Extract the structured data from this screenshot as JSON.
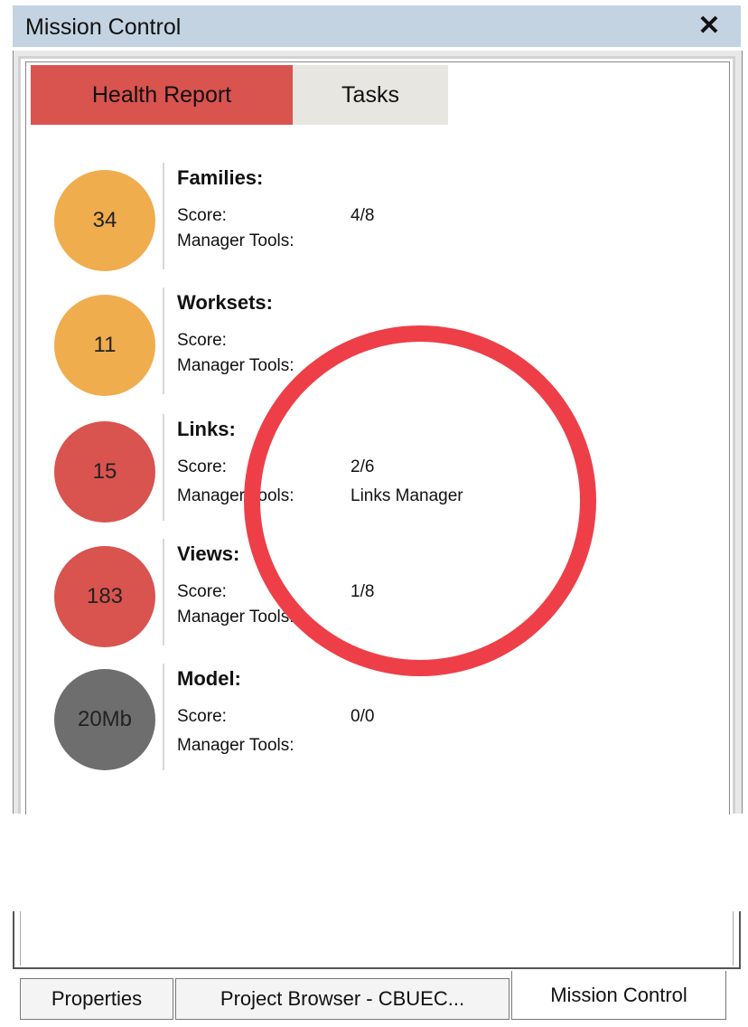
{
  "window": {
    "title": "Mission Control",
    "close_glyph": "✕"
  },
  "tabs": [
    {
      "label": "Health Report",
      "active": true
    },
    {
      "label": "Tasks",
      "active": false
    }
  ],
  "metrics": [
    {
      "title": "Families:",
      "value": "34",
      "score_label": "Score:",
      "score": "4/8",
      "tools_label": "Manager Tools:",
      "tools": "",
      "color": "#f0ad4e"
    },
    {
      "title": "Worksets:",
      "value": "11",
      "score_label": "Score:",
      "score": "",
      "tools_label": "Manager Tools:",
      "tools": "",
      "color": "#f0ad4e"
    },
    {
      "title": "Links:",
      "value": "15",
      "score_label": "Score:",
      "score": "2/6",
      "tools_label": "Manager Tools:",
      "tools": "Links Manager",
      "color": "#d9534f"
    },
    {
      "title": "Views:",
      "value": "183",
      "score_label": "Score:",
      "score": "1/8",
      "tools_label": "Manager Tools:",
      "tools": "",
      "color": "#d9534f"
    },
    {
      "title": "Model:",
      "value": "20Mb",
      "score_label": "Score:",
      "score": "0/0",
      "tools_label": "Manager Tools:",
      "tools": "",
      "color": "#6e6e6e"
    }
  ],
  "bottom_tabs": [
    {
      "label": "Properties",
      "active": false
    },
    {
      "label": "Project Browser - CBUEC...",
      "active": false
    },
    {
      "label": "Mission Control",
      "active": true
    }
  ],
  "annotation": {
    "color": "#ee3f48"
  }
}
